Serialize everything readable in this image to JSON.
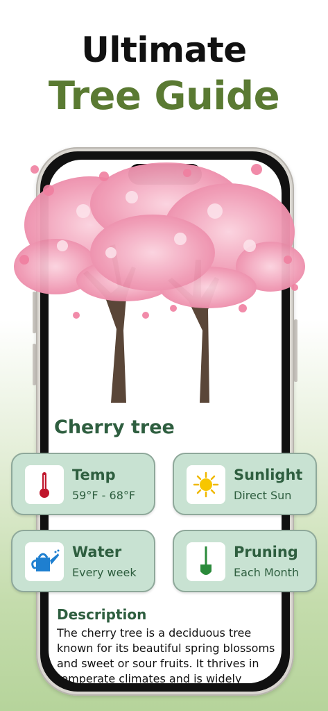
{
  "hero": {
    "line1": "Ultimate",
    "line2": "Tree Guide"
  },
  "species": {
    "name": "Cherry tree"
  },
  "cards": {
    "temp": {
      "title": "Temp",
      "value": "59°F - 68°F",
      "icon": "thermometer-icon"
    },
    "sunlight": {
      "title": "Sunlight",
      "value": "Direct Sun",
      "icon": "sun-icon"
    },
    "water": {
      "title": "Water",
      "value": "Every week",
      "icon": "watering-can-icon"
    },
    "pruning": {
      "title": "Pruning",
      "value": "Each Month",
      "icon": "shovel-icon"
    }
  },
  "description": {
    "title": "Description",
    "text": "The cherry tree is a deciduous tree known for its beautiful spring blossoms and sweet or sour fruits. It thrives in temperate climates and is widely"
  },
  "colors": {
    "accent": "#5a7a32",
    "heading": "#2e5e3f",
    "card_bg": "#c8e2d2",
    "blossom": "#f4a9c0"
  }
}
